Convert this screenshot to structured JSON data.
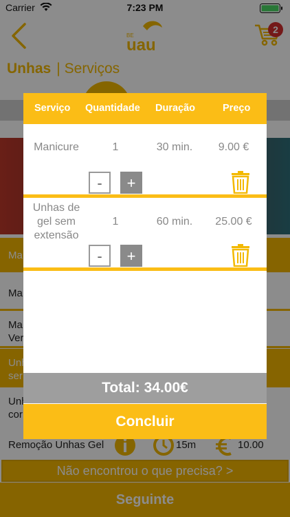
{
  "status_bar": {
    "carrier": "Carrier",
    "time": "7:23 PM"
  },
  "header": {
    "logo_small": "BE",
    "logo_main": "uau",
    "cart_count": "2"
  },
  "category": {
    "title": "Unhas",
    "subtitle": "Serviços"
  },
  "background_list": [
    {
      "label": "Ma"
    },
    {
      "label": "Ma"
    },
    {
      "label": "Ma"
    },
    {
      "label": "Ver"
    },
    {
      "label": "Unh"
    },
    {
      "label": "ser"
    },
    {
      "label": "Unh"
    },
    {
      "label": "cor"
    }
  ],
  "bottom_row": {
    "service": "Remoção Unhas Gel",
    "duration": "15m",
    "price": "10.00"
  },
  "not_found": "Não encontrou o que precisa?    >",
  "next_button": "Seguinte",
  "modal": {
    "columns": [
      "Serviço",
      "Quantidade",
      "Duração",
      "Preço"
    ],
    "items": [
      {
        "name": "Manicure",
        "quantity": "1",
        "duration": "30 min.",
        "price": "9.00 €"
      },
      {
        "name": "Unhas de gel sem extensão",
        "name_lines": [
          "Unhas de",
          "gel sem",
          "extensão"
        ],
        "quantity": "1",
        "duration": "60 min.",
        "price": "25.00 €"
      }
    ],
    "minus_label": "-",
    "plus_label": "+",
    "total": "Total: 34.00€",
    "confirm": "Concluir"
  }
}
